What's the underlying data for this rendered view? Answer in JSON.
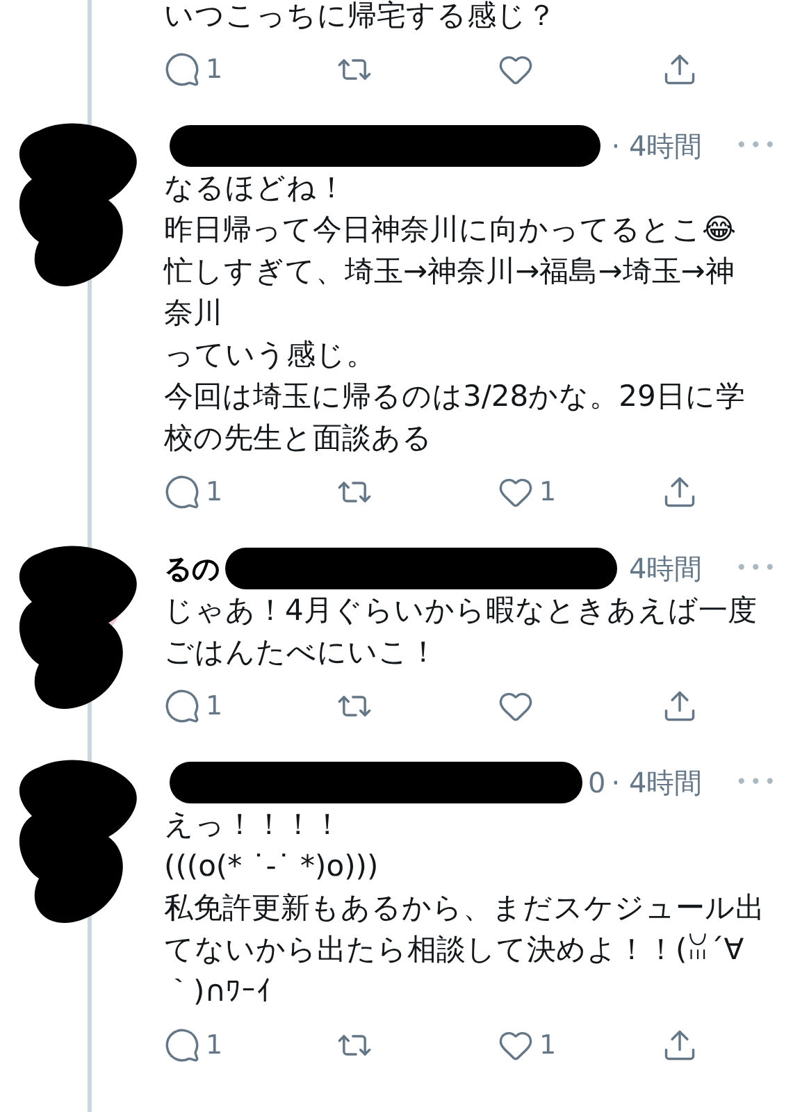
{
  "tweets": [
    {
      "lines": [
        "いつこっちに帰宅する感じ？"
      ],
      "reply_count": "1"
    },
    {
      "time": "· 4時間",
      "more": "•••",
      "lines": [
        "なるほどね！",
        "昨日帰って今日神奈川に向かってるとこ😂",
        "忙しすぎて、埼玉→神奈川→福島→埼玉→神",
        "奈川",
        "っていう感じ。",
        "今回は埼玉に帰るのは3/28かな。29日に学",
        "校の先生と面談ある"
      ],
      "reply_count": "1",
      "like_count": "1",
      "avatar": {
        "kind": "scribble"
      }
    },
    {
      "name": "るの",
      "time": "4時間",
      "more": "•••",
      "lines": [
        "じゃあ！4月ぐらいから暇なときあえば一度",
        "ごはんたべにいこ！"
      ],
      "reply_count": "1"
    },
    {
      "handle_tail": "0",
      "time": "· 4時間",
      "more": "•••",
      "lines": [
        "えっ！！！！",
        "(((o(* ˙-˙ *)o)))",
        "私免許更新もあるから、まだスケジュール出",
        "てないから出たら相談して決めよ！！(ꈍ´∀",
        "｀)∩ﾜｰｲ"
      ],
      "reply_count": "1",
      "like_count": "1",
      "avatar": {
        "kind": "scribble"
      }
    }
  ]
}
